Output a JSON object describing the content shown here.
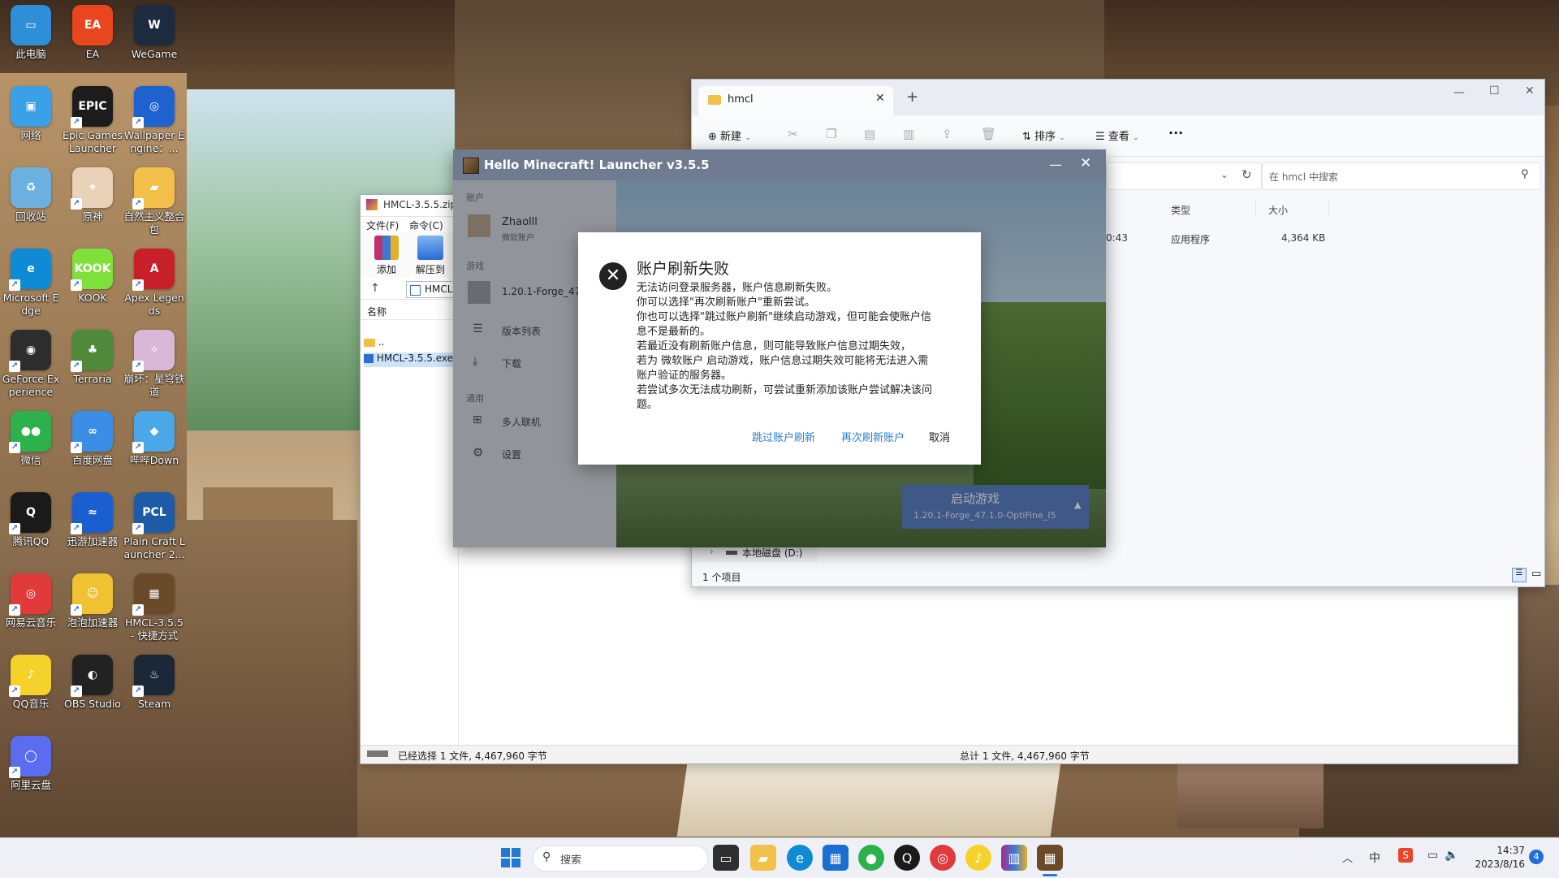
{
  "desktop_icons": [
    {
      "label": "此电脑",
      "color": "#2d8fd8",
      "glyph": "▭",
      "icon": "pc-icon"
    },
    {
      "label": "EA",
      "color": "#e8461e",
      "glyph": "EA",
      "icon": "ea-icon"
    },
    {
      "label": "WeGame",
      "color": "#1d2b3f",
      "glyph": "W",
      "icon": "wegame-icon"
    },
    {
      "label": "网络",
      "color": "#3aa0e8",
      "glyph": "▣",
      "icon": "network-icon"
    },
    {
      "label": "Epic Games Launcher",
      "color": "#1c1c1c",
      "glyph": "EPIC",
      "icon": "epic-icon"
    },
    {
      "label": "Wallpaper Engine：...",
      "color": "#1e62d0",
      "glyph": "◎",
      "icon": "wallpaper-engine-icon"
    },
    {
      "label": "回收站",
      "color": "#6cb0e0",
      "glyph": "♻",
      "icon": "recycle-bin-icon"
    },
    {
      "label": "原神",
      "color": "#e9d2b8",
      "glyph": "✦",
      "icon": "genshin-icon"
    },
    {
      "label": "自然主义整合包",
      "color": "#f2c04a",
      "glyph": "▰",
      "icon": "folder-icon"
    },
    {
      "label": "Microsoft Edge",
      "color": "#0f8bd6",
      "glyph": "e",
      "icon": "edge-icon"
    },
    {
      "label": "KOOK",
      "color": "#7ee13a",
      "glyph": "KOOK",
      "icon": "kook-icon"
    },
    {
      "label": "Apex Legends",
      "color": "#c8202a",
      "glyph": "A",
      "icon": "apex-icon"
    },
    {
      "label": "GeForce Experience",
      "color": "#2d2d2d",
      "glyph": "◉",
      "icon": "geforce-icon"
    },
    {
      "label": "Terraria",
      "color": "#4e8a3a",
      "glyph": "♣",
      "icon": "terraria-icon"
    },
    {
      "label": "崩坏：星穹铁道",
      "color": "#d9b7d9",
      "glyph": "✧",
      "icon": "starrail-icon"
    },
    {
      "label": "微信",
      "color": "#2bb24c",
      "glyph": "●●",
      "icon": "wechat-icon"
    },
    {
      "label": "百度网盘",
      "color": "#3a8ee6",
      "glyph": "∞",
      "icon": "baidu-netdisk-icon"
    },
    {
      "label": "哔哔Down",
      "color": "#4aa8e8",
      "glyph": "◆",
      "icon": "bbdown-icon"
    },
    {
      "label": "腾讯QQ",
      "color": "#1a1a1a",
      "glyph": "Q",
      "icon": "qq-icon"
    },
    {
      "label": "迅游加速器",
      "color": "#1a5fd0",
      "glyph": "≈",
      "icon": "xunyou-icon"
    },
    {
      "label": "Plain Craft Launcher 2...",
      "color": "#1d5ba8",
      "glyph": "PCL",
      "icon": "pcl-icon"
    },
    {
      "label": "网易云音乐",
      "color": "#e03a3a",
      "glyph": "◎",
      "icon": "netease-music-icon"
    },
    {
      "label": "泡泡加速器",
      "color": "#f0c232",
      "glyph": "☺",
      "icon": "paopao-icon"
    },
    {
      "label": "HMCL-3.5.5 - 快捷方式",
      "color": "#6b4a2a",
      "glyph": "▦",
      "icon": "hmcl-icon"
    },
    {
      "label": "QQ音乐",
      "color": "#f5d22a",
      "glyph": "♪",
      "icon": "qq-music-icon"
    },
    {
      "label": "OBS Studio",
      "color": "#222222",
      "glyph": "◐",
      "icon": "obs-icon"
    },
    {
      "label": "Steam",
      "color": "#1b2838",
      "glyph": "♨",
      "icon": "steam-icon"
    },
    {
      "label": "阿里云盘",
      "color": "#5a6cf0",
      "glyph": "◯",
      "icon": "aliyun-drive-icon"
    }
  ],
  "explorer": {
    "tab_title": "hmcl",
    "new_tab": "+",
    "toolbar": {
      "new": "新建",
      "sort": "排序",
      "view": "查看",
      "more": "···"
    },
    "search_placeholder": "在 hmcl 中搜索",
    "columns": {
      "type": "类型",
      "size": "大小"
    },
    "row": {
      "time": "0:43",
      "type": "应用程序",
      "size": "4,364 KB"
    },
    "nav_drive": "本地磁盘 (D:)",
    "status": "1 个项目"
  },
  "winrar": {
    "title": "HMCL-3.5.5.zip (",
    "menu": [
      "文件(F)",
      "命令(C)"
    ],
    "tools": [
      "添加",
      "解压到"
    ],
    "path": "HMCL",
    "col_name": "名称",
    "files": [
      "..",
      "HMCL-3.5.5.exe"
    ],
    "status_left": "已经选择 1 文件, 4,467,960 字节",
    "status_right": "总计 1 文件, 4,467,960 字节"
  },
  "hmcl": {
    "title": "Hello Minecraft! Launcher v3.5.5",
    "section_account": "账户",
    "account_name": "Zhaolll",
    "account_sub": "微软账户",
    "section_game": "游戏",
    "game_version": "1.20.1-Forge_47...",
    "version_list": "版本列表",
    "download": "下载",
    "section_general": "通用",
    "multiplayer": "多人联机",
    "settings": "设置",
    "launch_title": "启动游戏",
    "launch_sub": "1.20.1-Forge_47.1.0-OptiFine_I5"
  },
  "dialog": {
    "title": "账户刷新失败",
    "lines": [
      "无法访问登录服务器，账户信息刷新失败。",
      "你可以选择\"再次刷新账户\"重新尝试。",
      "你也可以选择\"跳过账户刷新\"继续启动游戏，但可能会使账户信",
      "息不是最新的。",
      "若最近没有刷新账户信息，则可能导致账户信息过期失效，",
      "若为 微软账户 启动游戏，账户信息过期失效可能将无法进入需",
      "账户验证的服务器。",
      "若尝试多次无法成功刷新，可尝试重新添加该账户尝试解决该问",
      "题。"
    ],
    "skip": "跳过账户刷新",
    "retry": "再次刷新账户",
    "cancel": "取消"
  },
  "taskbar": {
    "search": "搜索",
    "time": "14:37",
    "date": "2023/8/16",
    "ime": "中",
    "notification_count": "4"
  }
}
